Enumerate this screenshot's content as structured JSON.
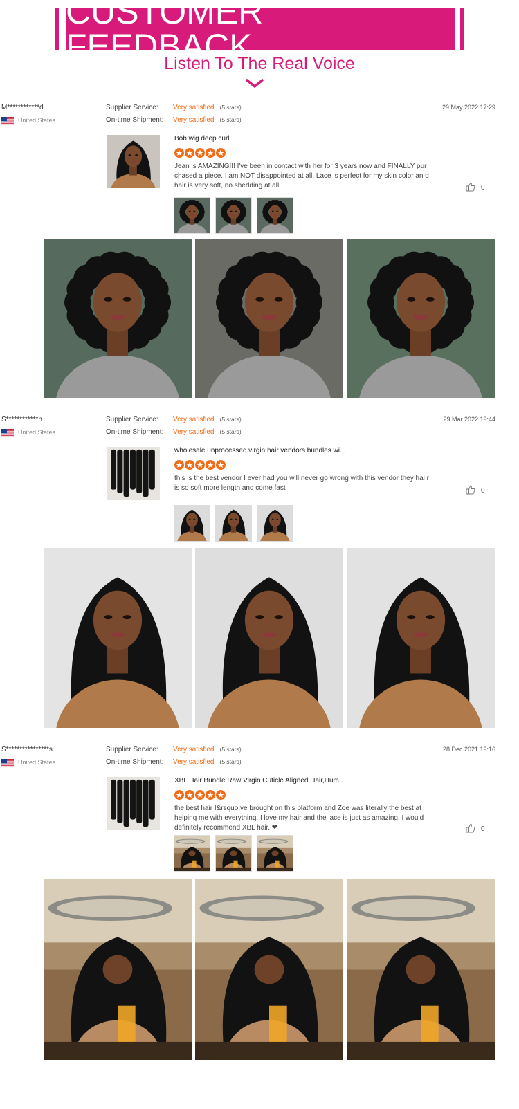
{
  "header": {
    "title": "CUSTOMER FEEDBACK",
    "subtitle": "Listen To The Real Voice",
    "accent_color": "#d81b7a",
    "chevron_icon": "chevron-down-icon"
  },
  "labels": {
    "supplier_service": "Supplier Service:",
    "ontime_shipment": "On-time Shipment:"
  },
  "reviews": [
    {
      "user": "M************d",
      "country": "United States",
      "date": "29 May 2022 17:29",
      "supplier_value": "Very satisfied",
      "supplier_stars": "(5 stars)",
      "shipment_value": "Very satisfied",
      "shipment_stars": "(5 stars)",
      "product_title": "Bob wig deep curl",
      "rating": 5,
      "text": "Jean is AMAZING!!! I've been in contact with her for 3 years now and FINALLY pur chased a piece. I am NOT disappointed at all. Lace is perfect for my skin color an d hair is very soft, no shedding at all.",
      "likes": "0"
    },
    {
      "user": "S************n",
      "country": "United States",
      "date": "29 Mar 2022 19:44",
      "supplier_value": "Very satisfied",
      "supplier_stars": "(5 stars)",
      "shipment_value": "Very satisfied",
      "shipment_stars": "(5 stars)",
      "product_title": "wholesale unprocessed virgin hair vendors bundles wi...",
      "rating": 5,
      "text": "this is the best vendor I ever had you will never go wrong with this vendor they hai r is so soft more length and come fast",
      "likes": "0"
    },
    {
      "user": "S****************s",
      "country": "United States",
      "date": "28 Dec 2021 19:16",
      "supplier_value": "Very satisfied",
      "supplier_stars": "(5 stars)",
      "shipment_value": "Very satisfied",
      "shipment_stars": "(5 stars)",
      "product_title": "XBL Hair Bundle Raw Virgin Cuticle Aligned Hair,Hum...",
      "rating": 5,
      "text": "the best hair I&rsquo;ve brought on this platform and Zoe was literally the best at helping me with everything. I love my hair and the lace is just as amazing. I would definitely recommend XBL hair. ❤",
      "likes": "0"
    }
  ],
  "colors": {
    "satisfied": "#f26c17",
    "star": "#f26c17"
  }
}
